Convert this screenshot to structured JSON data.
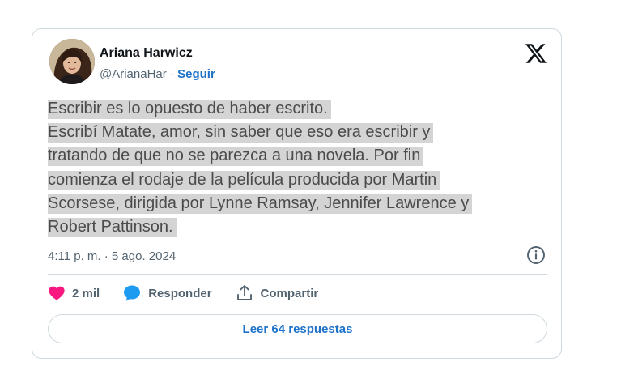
{
  "author": {
    "name": "Ariana Harwicz",
    "handle": "@ArianaHar",
    "separator": " · ",
    "follow_label": "Seguir"
  },
  "tweet": {
    "lines": [
      "Escribir es lo opuesto de haber escrito.",
      "Escribí Matate, amor, sin saber que eso era escribir y",
      "tratando de que no se parezca a una novela. Por fin",
      "comienza el rodaje de la película producida por Martin",
      "Scorsese, dirigida por Lynne Ramsay, Jennifer Lawrence y",
      "Robert Pattinson."
    ],
    "timestamp": "4:11 p. m. · 5 ago. 2024"
  },
  "actions": {
    "likes_count": "2 mil",
    "reply_label": "Responder",
    "share_label": "Compartir"
  },
  "read_replies_label": "Leer 64 respuestas",
  "icons": {
    "logo": "x-logo-icon",
    "info": "info-icon",
    "like": "heart-icon",
    "reply": "speech-bubble-icon",
    "share": "share-upload-icon"
  },
  "colors": {
    "accent_blue": "#1d72c9",
    "heart": "#f91880",
    "reply_bubble": "#1d9bf0",
    "text_highlight": "#d4d4d4",
    "border": "#cfd9de",
    "secondary_text": "#536471"
  }
}
